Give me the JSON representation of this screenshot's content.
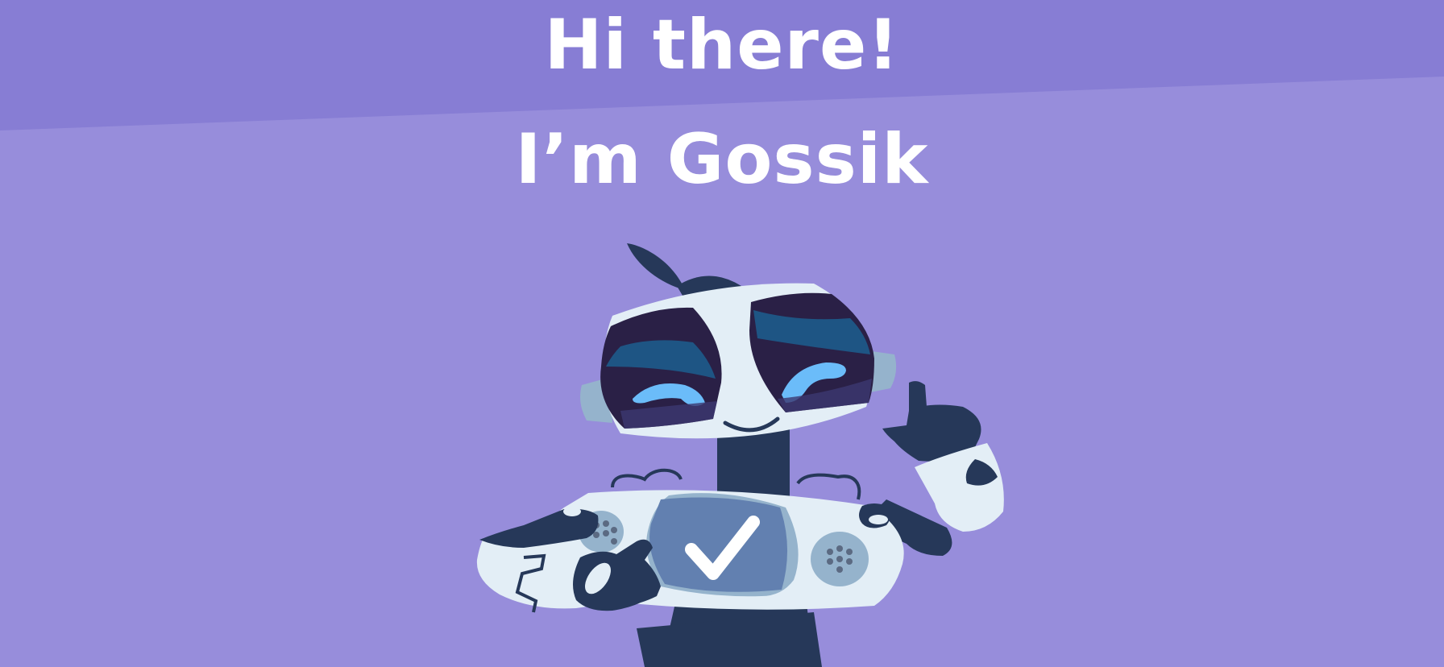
{
  "greeting": {
    "line1": "Hi there!",
    "line2": "I’m Gossik"
  },
  "colors": {
    "background": "#978ddb",
    "band": "#877dd4",
    "robot_dark": "#263859",
    "robot_white": "#e3eef6",
    "robot_grey": "#95b3cc",
    "eye_dark": "#2a2046",
    "eye_blue": "#1e5584",
    "eye_light": "#6bbcf9",
    "screen": "#6280b0"
  },
  "icons": {
    "robot": "robot-mascot-icon",
    "check": "check-icon"
  }
}
